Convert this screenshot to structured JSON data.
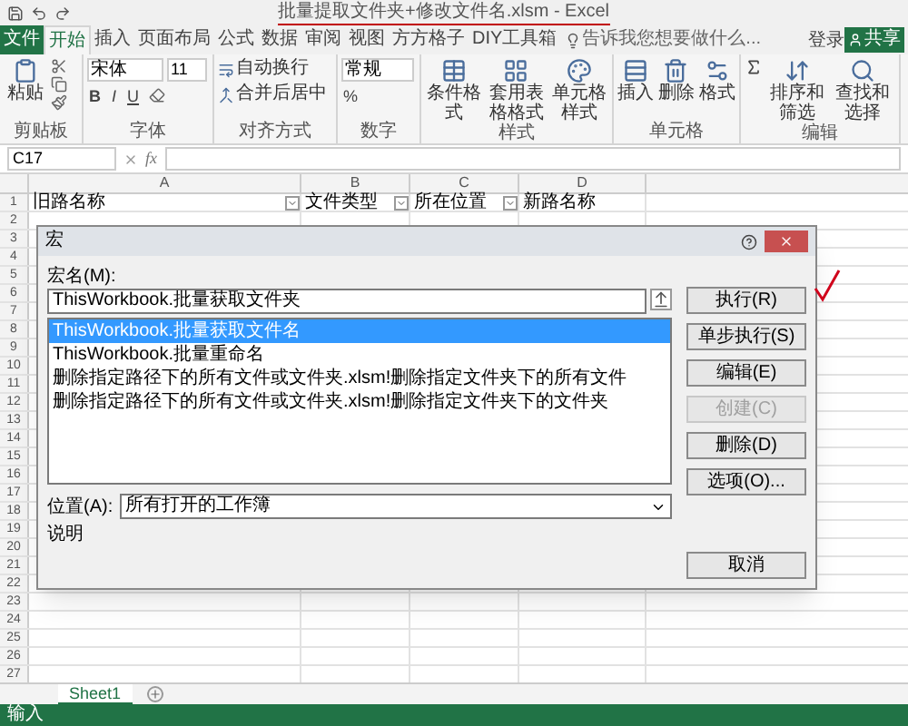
{
  "window": {
    "title": "批量提取文件夹+修改文件名.xlsm - Excel"
  },
  "tabs": [
    {
      "label": "文件",
      "selected": false,
      "kind": "file"
    },
    {
      "label": "开始",
      "selected": true,
      "kind": "tab"
    },
    {
      "label": "插入",
      "selected": false,
      "kind": "tab"
    },
    {
      "label": "页面布局",
      "selected": false,
      "kind": "tab"
    },
    {
      "label": "公式",
      "selected": false,
      "kind": "tab"
    },
    {
      "label": "数据",
      "selected": false,
      "kind": "tab"
    },
    {
      "label": "审阅",
      "selected": false,
      "kind": "tab"
    },
    {
      "label": "视图",
      "selected": false,
      "kind": "tab"
    },
    {
      "label": "方方格子",
      "selected": false,
      "kind": "tab"
    },
    {
      "label": "DIY工具箱",
      "selected": false,
      "kind": "tab"
    }
  ],
  "tell_me": {
    "placeholder": "告诉我您想要做什么..."
  },
  "sign_in": "登录",
  "share": "共享",
  "ribbon": {
    "paste": "粘贴",
    "font_name": "宋体",
    "font_size": "11",
    "bold": "B",
    "italic": "I",
    "underline": "U",
    "wrap_text": "自动换行",
    "merge_center": "合并后居中",
    "number_format": "常规",
    "percent": "%",
    "styles": [
      "条件格式",
      "套用表格格式",
      "单元格样式"
    ],
    "cells": [
      "插入",
      "删除",
      "格式"
    ],
    "editing": [
      "排序和筛选",
      "查找和选择"
    ],
    "groups": [
      "剪贴板",
      "字体",
      "对齐方式",
      "数字",
      "样式",
      "单元格",
      "编辑"
    ]
  },
  "name_box": "C17",
  "function_label": "fx",
  "sheet": {
    "columns": [
      "A",
      "B",
      "C",
      "D"
    ],
    "header_row": [
      {
        "text": "旧路名称",
        "filter": true
      },
      {
        "text": "文件类型",
        "filter": true
      },
      {
        "text": "所在位置",
        "filter": true
      },
      {
        "text": "新路名称",
        "filter": false
      }
    ],
    "row_numbers": [
      "1",
      "2",
      "3",
      "4",
      "5",
      "6",
      "7",
      "8",
      "9",
      "10",
      "11",
      "12",
      "13",
      "14",
      "15",
      "16",
      "17",
      "18",
      "19",
      "20",
      "21",
      "22",
      "23",
      "24",
      "25",
      "26",
      "27"
    ]
  },
  "dialog": {
    "title": "宏",
    "macro_name_label": "宏名(M):",
    "macro_name": "ThisWorkbook.批量获取文件夹",
    "macros": [
      {
        "name": "ThisWorkbook.批量获取文件名",
        "selected": true
      },
      {
        "name": "ThisWorkbook.批量重命名",
        "selected": false
      },
      {
        "name": "删除指定路径下的所有文件或文件夹.xlsm!删除指定文件夹下的所有文件",
        "selected": false
      },
      {
        "name": "删除指定路径下的所有文件或文件夹.xlsm!删除指定文件夹下的文件夹",
        "selected": false
      }
    ],
    "buttons": [
      {
        "label": "执行(R)",
        "disabled": false
      },
      {
        "label": "单步执行(S)",
        "disabled": false
      },
      {
        "label": "编辑(E)",
        "disabled": false
      },
      {
        "label": "创建(C)",
        "disabled": true
      },
      {
        "label": "删除(D)",
        "disabled": false
      },
      {
        "label": "选项(O)...",
        "disabled": false
      }
    ],
    "location_label": "位置(A):",
    "location": "所有打开的工作簿",
    "description_label": "说明",
    "cancel": "取消"
  },
  "sheet_tabs": [
    {
      "label": "Sheet1",
      "selected": true
    }
  ],
  "status_bar": {
    "mode": "输入"
  }
}
